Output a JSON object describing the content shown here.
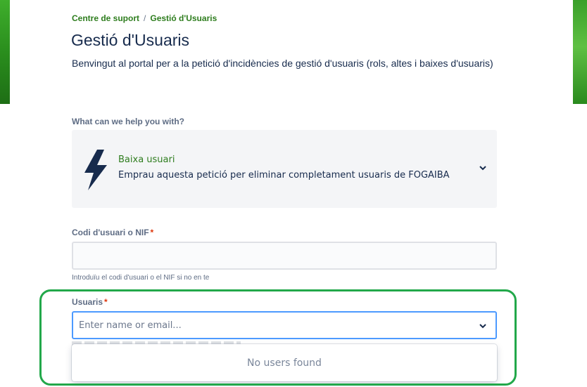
{
  "breadcrumb": {
    "items": [
      "Centre de suport",
      "Gestió d'Usuaris"
    ],
    "separator": "/"
  },
  "page": {
    "title": "Gestió d'Usuaris",
    "description": "Benvingut al portal per a la petició d'incidències de gestió d'usuaris (rols, altes i baixes d'usuaris)"
  },
  "request_type": {
    "section_label": "What can we help you with?",
    "selected_title": "Baixa usuari",
    "selected_description": "Emprau aquesta petició per eliminar completament usuaris de FOGAIBA",
    "icon": "lightning-bolt-icon"
  },
  "fields": {
    "user_code": {
      "label": "Codi d'usuari o NIF",
      "required_marker": "*",
      "value": "",
      "helper": "Introduïu el codi d'usuari o el NIF si no en te"
    },
    "users": {
      "label": "Usuaris",
      "required_marker": "*",
      "placeholder": "Enter name or email...",
      "dropdown_message": "No users found"
    }
  },
  "colors": {
    "brand_green": "#2e7d1e",
    "focus_blue": "#4c9aff",
    "required_red": "#de350b",
    "highlight_green": "#22a84a"
  }
}
